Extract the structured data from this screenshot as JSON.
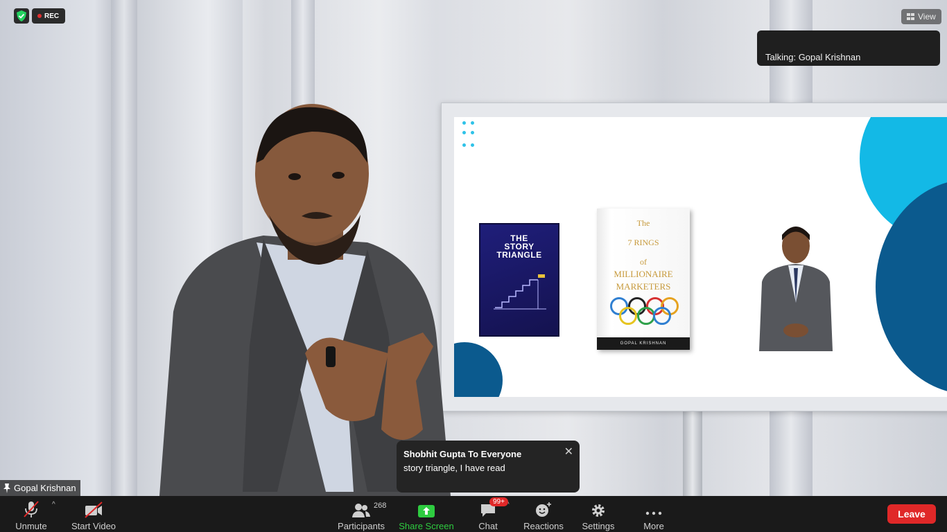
{
  "recording": {
    "label": "REC"
  },
  "view": {
    "label": "View"
  },
  "talking": {
    "text": "Talking: Gopal Krishnan"
  },
  "slide": {
    "book1": {
      "title_line1": "THE",
      "title_line2": "STORY",
      "title_line3": "TRIANGLE"
    },
    "book2": {
      "title_line1": "The",
      "title_line2": "7 RINGS",
      "title_line3": "of",
      "title_line4": "MILLIONAIRE",
      "title_line5": "MARKETERS",
      "author": "GOPAL KRISHNAN"
    }
  },
  "speaker": {
    "name": "Gopal Krishnan"
  },
  "chat_notification": {
    "from": "Shobhit Gupta To Everyone",
    "message": "story triangle, I have read",
    "close": "✕"
  },
  "toolbar": {
    "unmute": "Unmute",
    "start_video": "Start Video",
    "participants": "Participants",
    "participants_count": "268",
    "share_screen": "Share Screen",
    "chat": "Chat",
    "chat_badge": "99+",
    "reactions": "Reactions",
    "settings": "Settings",
    "more": "More",
    "leave": "Leave"
  },
  "colors": {
    "share_green": "#2ecc40",
    "leave_red": "#e02828",
    "accent_cyan": "#13b9e6",
    "accent_navy": "#0b5a8e"
  }
}
